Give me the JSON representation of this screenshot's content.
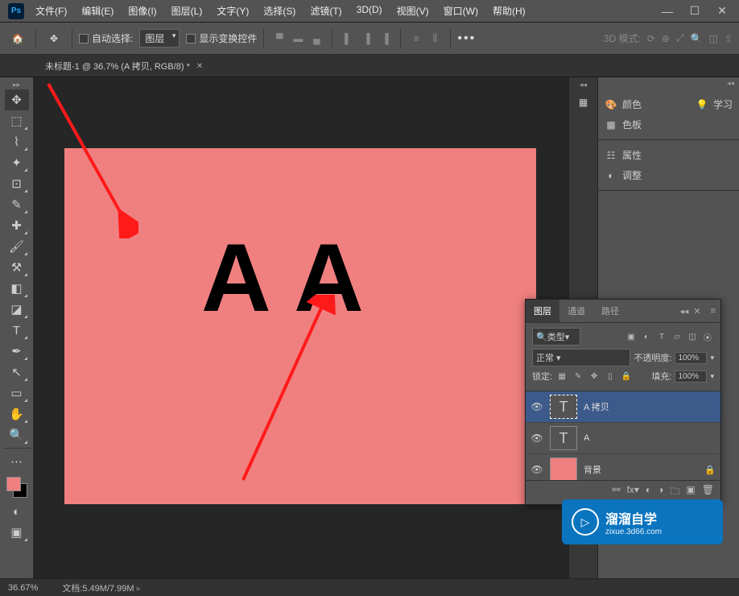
{
  "menu": {
    "items": [
      "文件(F)",
      "编辑(E)",
      "图像(I)",
      "图层(L)",
      "文字(Y)",
      "选择(S)",
      "滤镜(T)",
      "3D(D)",
      "视图(V)",
      "窗口(W)",
      "帮助(H)"
    ]
  },
  "options": {
    "auto_select_label": "自动选择:",
    "layer_dropdown": "图层",
    "show_transform_label": "显示变换控件",
    "mode3d_label": "3D 模式:"
  },
  "tab": {
    "title": "未标题-1 @ 36.7% (A 拷贝, RGB/8) *"
  },
  "canvas": {
    "text": "A A"
  },
  "right_panels": {
    "color_tab": "颜色",
    "learn_tab": "学习",
    "swatches_tab": "色板",
    "properties_tab": "属性",
    "adjustments_tab": "调整"
  },
  "layers": {
    "tabs": {
      "layers": "图层",
      "channels": "通道",
      "paths": "路径"
    },
    "search_placeholder": "类型",
    "blend_mode": "正常",
    "opacity_label": "不透明度:",
    "opacity_value": "100%",
    "lock_label": "锁定:",
    "fill_label": "填充:",
    "fill_value": "100%",
    "items": [
      {
        "name": "A 拷贝",
        "thumb": "T",
        "selected": true
      },
      {
        "name": "A",
        "thumb": "T",
        "selected": false
      },
      {
        "name": "背景",
        "thumb": "bg",
        "selected": false,
        "locked": true
      }
    ]
  },
  "watermark": {
    "title": "溜溜自学",
    "url": "zixue.3d66.com"
  },
  "status": {
    "zoom": "36.67%",
    "doc_label": "文档:",
    "doc_size": "5.49M/7.99M"
  }
}
